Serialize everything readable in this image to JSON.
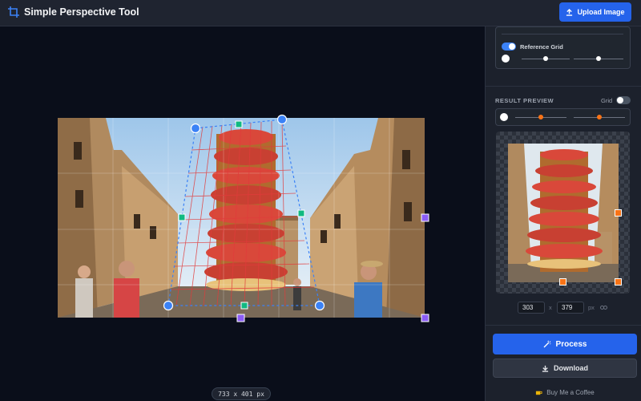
{
  "header": {
    "title": "Simple Perspective Tool",
    "upload_label": "Upload Image"
  },
  "canvas": {
    "dimension_label": "733 x 401 px"
  },
  "sidebar": {
    "reference_grid_label": "Reference Grid",
    "reference_grid_on": true,
    "result_preview_label": "RESULT PREVIEW",
    "grid_toggle_label": "Grid",
    "grid_toggle_on": false,
    "width_value": "303",
    "height_value": "379",
    "times_sign": "x",
    "unit": "px",
    "link_icon": "link-icon",
    "process_label": "Process",
    "download_label": "Download",
    "coffee_label": "Buy Me a Coffee"
  },
  "colors": {
    "accent": "#2563eb",
    "handle_blue": "#3b82f6",
    "handle_green": "#10b981",
    "handle_purple": "#8b5cf6",
    "handle_orange": "#f97316"
  }
}
